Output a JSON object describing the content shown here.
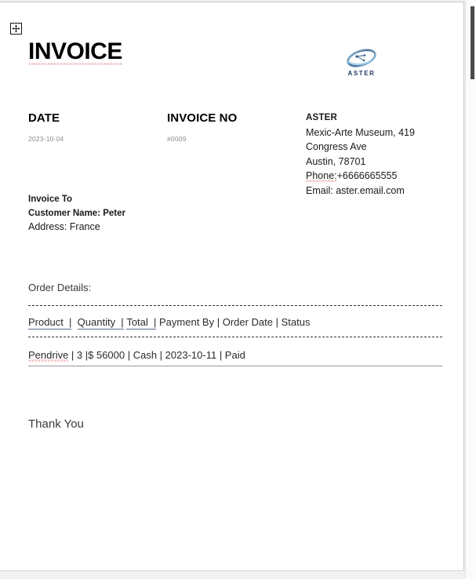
{
  "document": {
    "title": "INVOICE"
  },
  "handles": {
    "move_handle_icon": "move-handle-icon"
  },
  "logo": {
    "icon": "aster-swoosh-logo-icon",
    "wordmark": "ASTER",
    "colors": {
      "swoosh_dark": "#2e5c8a",
      "swoosh_light": "#7fb7d9",
      "wordmark": "#253a66"
    }
  },
  "meta": {
    "date_label": "DATE",
    "date_value": "2023-10-04",
    "invoice_no_label": "INVOICE NO",
    "invoice_no_value": "#0009"
  },
  "company": {
    "name": "ASTER",
    "address_line1": "Mexic-Arte Museum, 419",
    "address_line2": "Congress Ave",
    "address_line3": "Austin, 78701",
    "phone_label": "Phone:",
    "phone_value": "+6666665555",
    "email_line": "Email: aster.email.com"
  },
  "bill_to": {
    "heading": "Invoice To",
    "customer_line": "Customer Name: Peter",
    "address_line": "Address: France"
  },
  "order": {
    "section_label": "Order Details:",
    "separator_top": "----------------------------------------------------------------------------------------------------",
    "separator_bottom": "----------------------------------------------------------------------------------------------------",
    "headers": {
      "product": "Product",
      "quantity": "Quantity",
      "total": "Total",
      "rest": "Payment By | Order Date | Status",
      "pipe": "|"
    },
    "rows": [
      {
        "product": "Pendrive",
        "rest": " | 3 |$ 56000 | Cash | 2023-10-11 | Paid"
      }
    ]
  },
  "footer": {
    "thanks": "Thank You"
  },
  "scrollbar": {
    "name": "vertical-scrollbar"
  }
}
